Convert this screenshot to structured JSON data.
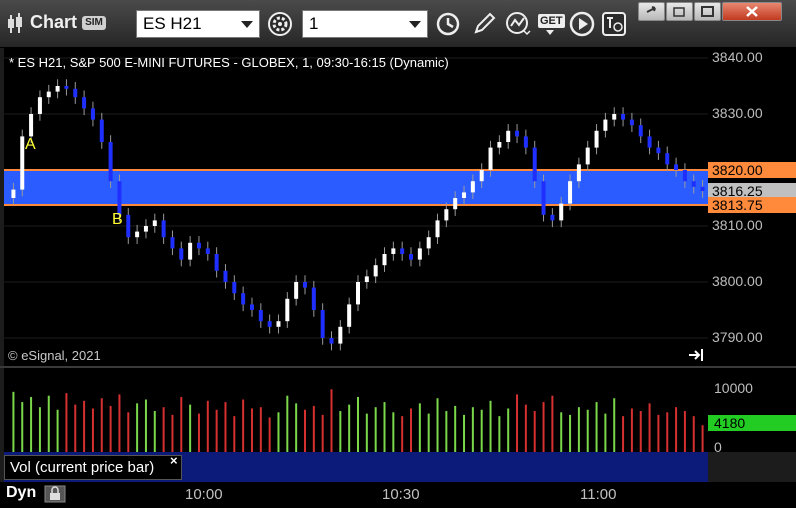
{
  "app": {
    "title": "Chart",
    "sim_badge": "SIM"
  },
  "toolbar": {
    "symbol": "ES H21",
    "interval": "1",
    "get_label": "GET"
  },
  "chart": {
    "description": "* ES H21, S&P 500 E-MINI FUTURES - GLOBEX, 1, 09:30-16:15 (Dynamic)",
    "copyright": "© eSignal, 2021",
    "label_a": "A",
    "label_b": "B",
    "price_axis": [
      "3840.00",
      "3830.00",
      "3820.00",
      "3810.00",
      "3800.00",
      "3790.00"
    ],
    "tags": {
      "upper": "3820.00",
      "last": "3816.25",
      "lower": "3813.75"
    },
    "colors": {
      "band": "#2a5cff",
      "up": "#ffffff",
      "down": "#1f2fff",
      "band_edge": "#ff8a3c",
      "vol_up": "#7ad84a",
      "vol_down": "#d63030",
      "last_tag": "#c0c0c0"
    }
  },
  "volume": {
    "axis": [
      "10000",
      "0"
    ],
    "last": "4180",
    "study_label": "Vol (current price bar)",
    "close_glyph": "×"
  },
  "time_axis": {
    "mode": "Dyn",
    "ticks": [
      "10:00",
      "10:30",
      "11:00"
    ]
  },
  "chart_data": {
    "type": "candlestick",
    "y_range": [
      3786,
      3841
    ],
    "band": {
      "top": 3820.0,
      "bottom": 3813.75
    },
    "price_path": [
      3816.5,
      3826,
      3830,
      3833,
      3834,
      3835,
      3834.5,
      3833,
      3831,
      3829,
      3825,
      3818,
      3812,
      3808,
      3809,
      3810,
      3811,
      3808,
      3806,
      3804,
      3807,
      3806,
      3805,
      3802,
      3800,
      3798,
      3796,
      3795,
      3793,
      3792,
      3793,
      3797,
      3800,
      3799,
      3795,
      3790,
      3789,
      3792,
      3796,
      3800,
      3801,
      3803,
      3805,
      3806,
      3805,
      3804,
      3806,
      3808,
      3811,
      3813,
      3815,
      3816,
      3818,
      3820,
      3824,
      3825,
      3827,
      3826,
      3824,
      3818,
      3812,
      3811,
      3814,
      3818,
      3821,
      3824,
      3827,
      3829,
      3830,
      3829,
      3828,
      3826,
      3824,
      3823,
      3821,
      3820,
      3818,
      3817,
      3816.25
    ],
    "volume_values": [
      9400,
      7800,
      8600,
      7000,
      8800,
      6600,
      9200,
      7400,
      8000,
      6800,
      8400,
      7200,
      9000,
      6200,
      7600,
      8200,
      6400,
      7000,
      5800,
      8600,
      7400,
      6000,
      8000,
      6600,
      7800,
      5600,
      8200,
      6800,
      7000,
      5400,
      6200,
      8800,
      7600,
      6600,
      7200,
      5800,
      9800,
      6400,
      7400,
      8600,
      6000,
      7000,
      7800,
      6200,
      5600,
      6800,
      7600,
      6000,
      8400,
      6400,
      7200,
      5800,
      7000,
      6600,
      8000,
      5600,
      6800,
      9000,
      7400,
      6400,
      7800,
      8800,
      6200,
      5800,
      7000,
      6600,
      7800,
      6000,
      8400,
      5600,
      6800,
      6400,
      7600,
      5800,
      6200,
      7000,
      6400,
      5600,
      4180
    ]
  }
}
